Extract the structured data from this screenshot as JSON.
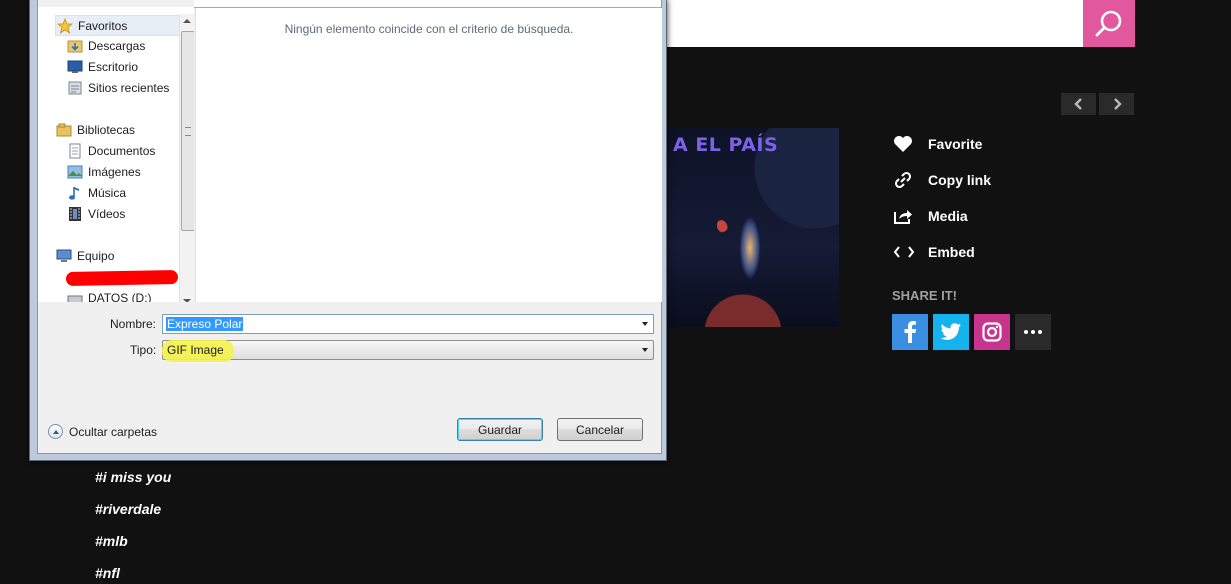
{
  "dialog": {
    "nav": {
      "favorites": "Favoritos",
      "downloads": "Descargas",
      "desktop": "Escritorio",
      "recent": "Sitios recientes",
      "libraries": "Bibliotecas",
      "documents": "Documentos",
      "images": "Imágenes",
      "music": "Música",
      "videos": "Vídeos",
      "computer": "Equipo",
      "drive": "DATOS (D:)"
    },
    "empty_message": "Ningún elemento coincide con el criterio de búsqueda.",
    "name_label": "Nombre:",
    "name_value": "Expreso Polar",
    "type_label": "Tipo:",
    "type_value": "GIF Image",
    "hide_folders": "Ocultar carpetas",
    "save": "Guardar",
    "cancel": "Cancelar"
  },
  "page": {
    "gif_caption": "A EL PAÍS",
    "actions": {
      "favorite": "Favorite",
      "copy_link": "Copy link",
      "media": "Media",
      "embed": "Embed"
    },
    "share_title": "SHARE IT!",
    "tags": [
      "#i miss you",
      "#riverdale",
      "#mlb",
      "#nfl"
    ],
    "colors": {
      "search_button": "#e2589e",
      "facebook": "#3b8fe3",
      "twitter": "#15b3ee",
      "instagram": "#c7348e",
      "background": "#121111"
    }
  }
}
